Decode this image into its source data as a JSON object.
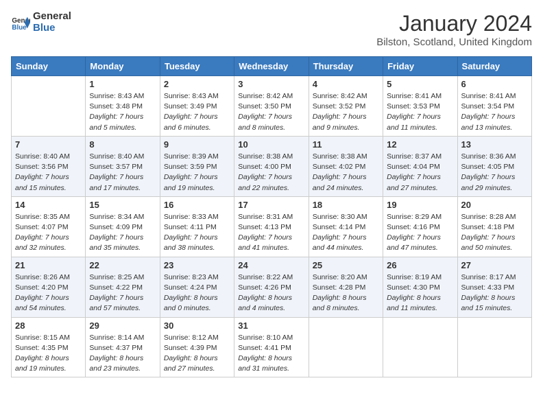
{
  "logo": {
    "line1": "General",
    "line2": "Blue"
  },
  "title": "January 2024",
  "location": "Bilston, Scotland, United Kingdom",
  "days_of_week": [
    "Sunday",
    "Monday",
    "Tuesday",
    "Wednesday",
    "Thursday",
    "Friday",
    "Saturday"
  ],
  "weeks": [
    [
      {
        "day": "",
        "sunrise": "",
        "sunset": "",
        "daylight": ""
      },
      {
        "day": "1",
        "sunrise": "Sunrise: 8:43 AM",
        "sunset": "Sunset: 3:48 PM",
        "daylight": "Daylight: 7 hours and 5 minutes."
      },
      {
        "day": "2",
        "sunrise": "Sunrise: 8:43 AM",
        "sunset": "Sunset: 3:49 PM",
        "daylight": "Daylight: 7 hours and 6 minutes."
      },
      {
        "day": "3",
        "sunrise": "Sunrise: 8:42 AM",
        "sunset": "Sunset: 3:50 PM",
        "daylight": "Daylight: 7 hours and 8 minutes."
      },
      {
        "day": "4",
        "sunrise": "Sunrise: 8:42 AM",
        "sunset": "Sunset: 3:52 PM",
        "daylight": "Daylight: 7 hours and 9 minutes."
      },
      {
        "day": "5",
        "sunrise": "Sunrise: 8:41 AM",
        "sunset": "Sunset: 3:53 PM",
        "daylight": "Daylight: 7 hours and 11 minutes."
      },
      {
        "day": "6",
        "sunrise": "Sunrise: 8:41 AM",
        "sunset": "Sunset: 3:54 PM",
        "daylight": "Daylight: 7 hours and 13 minutes."
      }
    ],
    [
      {
        "day": "7",
        "sunrise": "Sunrise: 8:40 AM",
        "sunset": "Sunset: 3:56 PM",
        "daylight": "Daylight: 7 hours and 15 minutes."
      },
      {
        "day": "8",
        "sunrise": "Sunrise: 8:40 AM",
        "sunset": "Sunset: 3:57 PM",
        "daylight": "Daylight: 7 hours and 17 minutes."
      },
      {
        "day": "9",
        "sunrise": "Sunrise: 8:39 AM",
        "sunset": "Sunset: 3:59 PM",
        "daylight": "Daylight: 7 hours and 19 minutes."
      },
      {
        "day": "10",
        "sunrise": "Sunrise: 8:38 AM",
        "sunset": "Sunset: 4:00 PM",
        "daylight": "Daylight: 7 hours and 22 minutes."
      },
      {
        "day": "11",
        "sunrise": "Sunrise: 8:38 AM",
        "sunset": "Sunset: 4:02 PM",
        "daylight": "Daylight: 7 hours and 24 minutes."
      },
      {
        "day": "12",
        "sunrise": "Sunrise: 8:37 AM",
        "sunset": "Sunset: 4:04 PM",
        "daylight": "Daylight: 7 hours and 27 minutes."
      },
      {
        "day": "13",
        "sunrise": "Sunrise: 8:36 AM",
        "sunset": "Sunset: 4:05 PM",
        "daylight": "Daylight: 7 hours and 29 minutes."
      }
    ],
    [
      {
        "day": "14",
        "sunrise": "Sunrise: 8:35 AM",
        "sunset": "Sunset: 4:07 PM",
        "daylight": "Daylight: 7 hours and 32 minutes."
      },
      {
        "day": "15",
        "sunrise": "Sunrise: 8:34 AM",
        "sunset": "Sunset: 4:09 PM",
        "daylight": "Daylight: 7 hours and 35 minutes."
      },
      {
        "day": "16",
        "sunrise": "Sunrise: 8:33 AM",
        "sunset": "Sunset: 4:11 PM",
        "daylight": "Daylight: 7 hours and 38 minutes."
      },
      {
        "day": "17",
        "sunrise": "Sunrise: 8:31 AM",
        "sunset": "Sunset: 4:13 PM",
        "daylight": "Daylight: 7 hours and 41 minutes."
      },
      {
        "day": "18",
        "sunrise": "Sunrise: 8:30 AM",
        "sunset": "Sunset: 4:14 PM",
        "daylight": "Daylight: 7 hours and 44 minutes."
      },
      {
        "day": "19",
        "sunrise": "Sunrise: 8:29 AM",
        "sunset": "Sunset: 4:16 PM",
        "daylight": "Daylight: 7 hours and 47 minutes."
      },
      {
        "day": "20",
        "sunrise": "Sunrise: 8:28 AM",
        "sunset": "Sunset: 4:18 PM",
        "daylight": "Daylight: 7 hours and 50 minutes."
      }
    ],
    [
      {
        "day": "21",
        "sunrise": "Sunrise: 8:26 AM",
        "sunset": "Sunset: 4:20 PM",
        "daylight": "Daylight: 7 hours and 54 minutes."
      },
      {
        "day": "22",
        "sunrise": "Sunrise: 8:25 AM",
        "sunset": "Sunset: 4:22 PM",
        "daylight": "Daylight: 7 hours and 57 minutes."
      },
      {
        "day": "23",
        "sunrise": "Sunrise: 8:23 AM",
        "sunset": "Sunset: 4:24 PM",
        "daylight": "Daylight: 8 hours and 0 minutes."
      },
      {
        "day": "24",
        "sunrise": "Sunrise: 8:22 AM",
        "sunset": "Sunset: 4:26 PM",
        "daylight": "Daylight: 8 hours and 4 minutes."
      },
      {
        "day": "25",
        "sunrise": "Sunrise: 8:20 AM",
        "sunset": "Sunset: 4:28 PM",
        "daylight": "Daylight: 8 hours and 8 minutes."
      },
      {
        "day": "26",
        "sunrise": "Sunrise: 8:19 AM",
        "sunset": "Sunset: 4:30 PM",
        "daylight": "Daylight: 8 hours and 11 minutes."
      },
      {
        "day": "27",
        "sunrise": "Sunrise: 8:17 AM",
        "sunset": "Sunset: 4:33 PM",
        "daylight": "Daylight: 8 hours and 15 minutes."
      }
    ],
    [
      {
        "day": "28",
        "sunrise": "Sunrise: 8:15 AM",
        "sunset": "Sunset: 4:35 PM",
        "daylight": "Daylight: 8 hours and 19 minutes."
      },
      {
        "day": "29",
        "sunrise": "Sunrise: 8:14 AM",
        "sunset": "Sunset: 4:37 PM",
        "daylight": "Daylight: 8 hours and 23 minutes."
      },
      {
        "day": "30",
        "sunrise": "Sunrise: 8:12 AM",
        "sunset": "Sunset: 4:39 PM",
        "daylight": "Daylight: 8 hours and 27 minutes."
      },
      {
        "day": "31",
        "sunrise": "Sunrise: 8:10 AM",
        "sunset": "Sunset: 4:41 PM",
        "daylight": "Daylight: 8 hours and 31 minutes."
      },
      {
        "day": "",
        "sunrise": "",
        "sunset": "",
        "daylight": ""
      },
      {
        "day": "",
        "sunrise": "",
        "sunset": "",
        "daylight": ""
      },
      {
        "day": "",
        "sunrise": "",
        "sunset": "",
        "daylight": ""
      }
    ]
  ]
}
